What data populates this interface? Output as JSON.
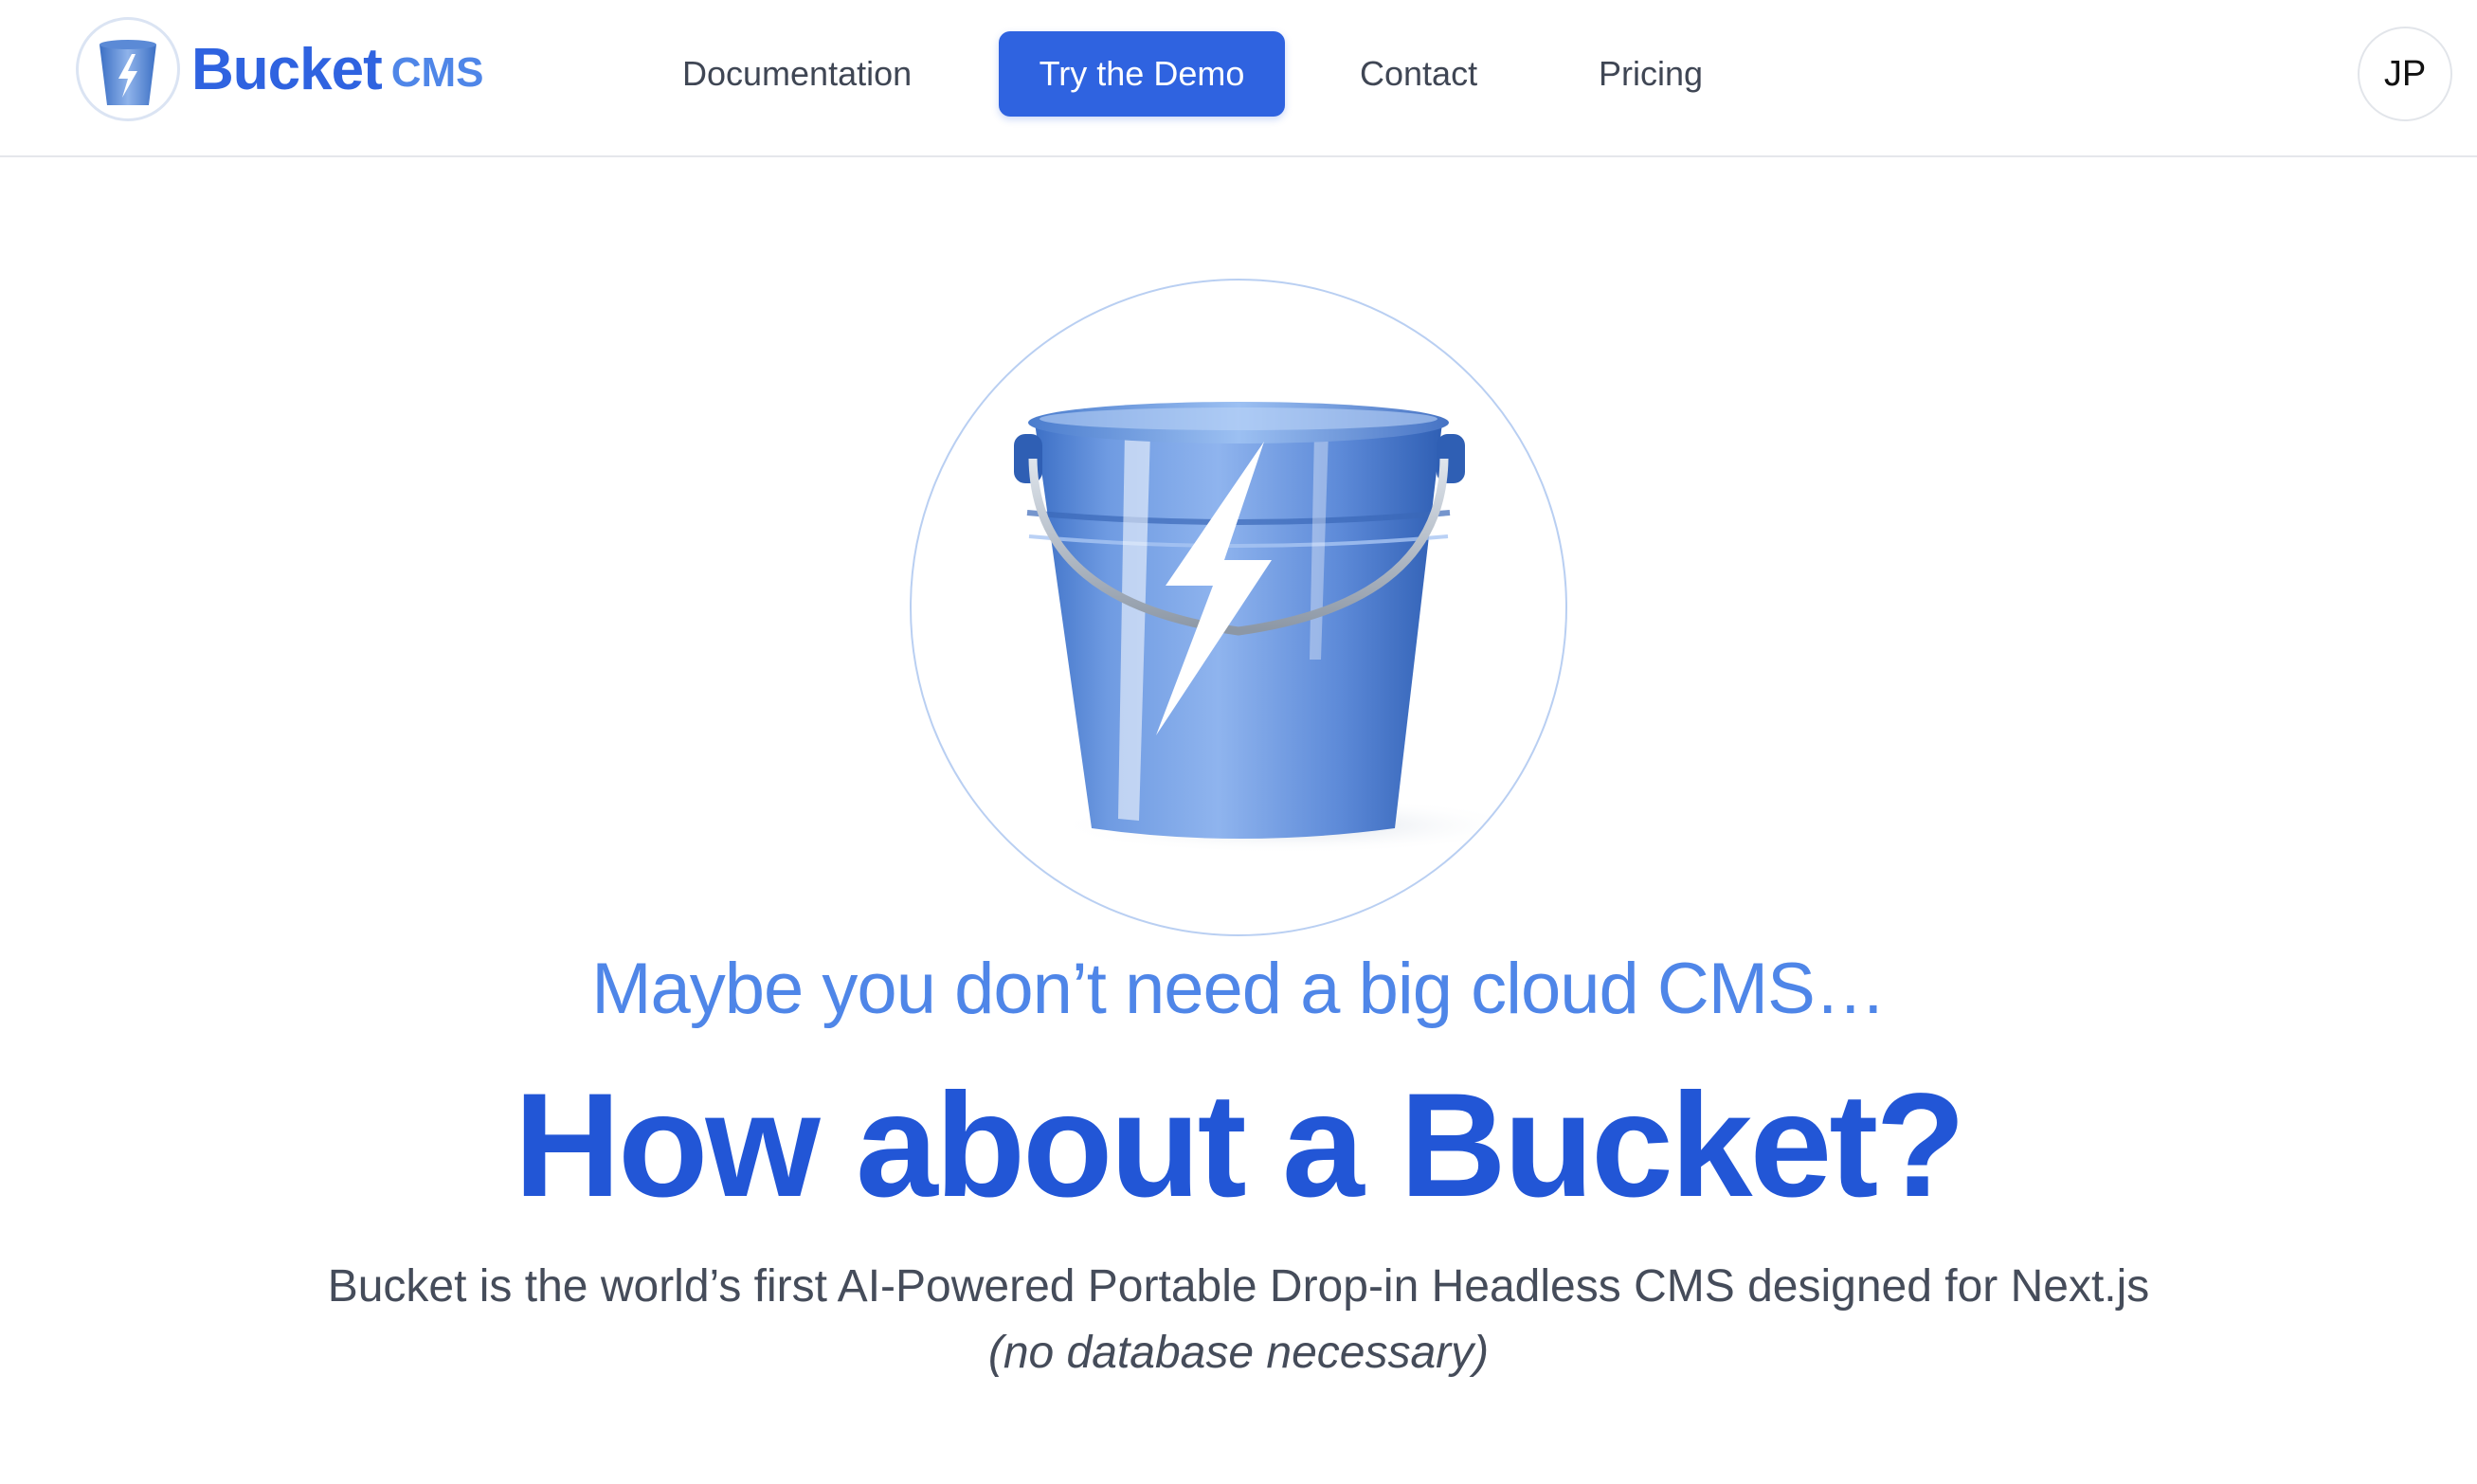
{
  "header": {
    "logo": {
      "brand": "Bucket",
      "suffix": "CMS",
      "icon": "bucket-lightning-icon"
    },
    "nav": {
      "documentation": "Documentation",
      "demo": "Try the Demo",
      "contact": "Contact",
      "pricing": "Pricing"
    },
    "avatar_initials": "JP"
  },
  "hero": {
    "image_icon": "bucket-lightning-illustration",
    "subtitle": "Maybe you don’t need a big cloud CMS…",
    "headline": "How about a Bucket?",
    "description": "Bucket is the world’s first AI-Powered Portable Drop-in Headless CMS designed for Next.js",
    "note": "(no database necessary)"
  },
  "colors": {
    "brand_blue": "#2f63e0",
    "headline_blue": "#2256d6",
    "subtitle_blue": "#4f86e8",
    "text_gray": "#454c5a",
    "border_gray": "#e5e7eb"
  }
}
